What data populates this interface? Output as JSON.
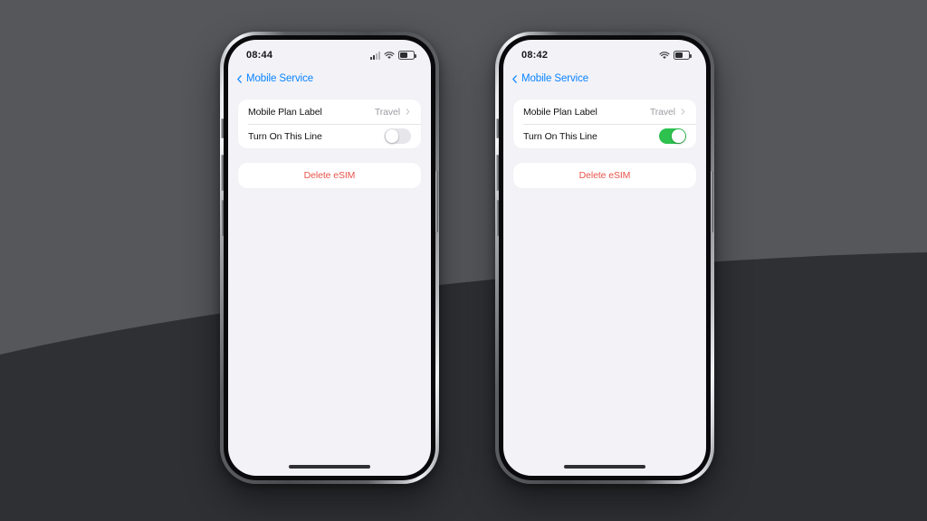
{
  "scene": {
    "background_color": "#55575b",
    "curve_color": "#2e3034"
  },
  "theme": {
    "screen_bg": "#f2f2f7",
    "card_bg": "#ffffff",
    "tint_blue": "#0a84ff",
    "destructive_red": "#e8544b",
    "toggle_on_green": "#2dc14e",
    "toggle_off_gray": "#e6e6eb",
    "label_color": "#111216",
    "secondary_label_color": "#9c9ca3"
  },
  "phones": [
    {
      "id": "left",
      "status_bar": {
        "time": "08:44",
        "cellular_icon": "cellular-bars-icon",
        "cellular_visible": true,
        "wifi_icon": "wifi-icon",
        "battery_icon": "battery-icon",
        "battery_level": 55
      },
      "nav": {
        "back_icon": "chevron-left-icon",
        "back_label": "Mobile Service"
      },
      "settings_group": {
        "rows": [
          {
            "label": "Mobile Plan Label",
            "value": "Travel",
            "accessory": "chevron-right-icon",
            "type": "disclosure"
          },
          {
            "label": "Turn On This Line",
            "type": "toggle",
            "toggle_state": "off"
          }
        ]
      },
      "destructive_action": {
        "label": "Delete eSIM"
      },
      "home_indicator": "home-indicator"
    },
    {
      "id": "right",
      "status_bar": {
        "time": "08:42",
        "cellular_icon": "cellular-bars-icon",
        "cellular_visible": false,
        "wifi_icon": "wifi-icon",
        "battery_icon": "battery-icon",
        "battery_level": 55
      },
      "nav": {
        "back_icon": "chevron-left-icon",
        "back_label": "Mobile Service"
      },
      "settings_group": {
        "rows": [
          {
            "label": "Mobile Plan Label",
            "value": "Travel",
            "accessory": "chevron-right-icon",
            "type": "disclosure"
          },
          {
            "label": "Turn On This Line",
            "type": "toggle",
            "toggle_state": "on"
          }
        ]
      },
      "destructive_action": {
        "label": "Delete eSIM"
      },
      "home_indicator": "home-indicator"
    }
  ]
}
